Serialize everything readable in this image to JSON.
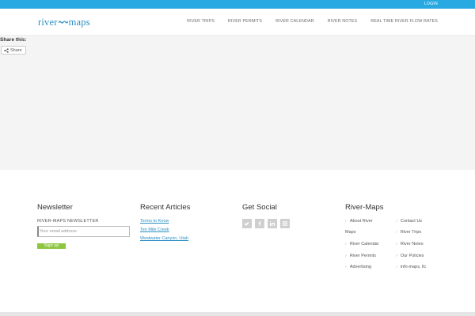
{
  "topbar": {
    "login": "LOGIN"
  },
  "logo": {
    "left": "river",
    "right": "maps"
  },
  "nav": [
    "RIVER TRIPS",
    "RIVER PERMITS",
    "RIVER CALENDAR",
    "RIVER NOTES",
    "REAL TIME RIVER FLOW RATES"
  ],
  "share": {
    "title": "Share this:",
    "button": "Share"
  },
  "footer": {
    "newsletter": {
      "heading": "Newsletter",
      "label": "RIVER-MAPS NEWSLETTER",
      "placeholder": "Your email address",
      "button": "Sign up"
    },
    "articles": {
      "heading": "Recent Articles",
      "items": [
        "Terms to Know",
        "Ten Mile Creek",
        "Westwater Canyon, Utah"
      ]
    },
    "social": {
      "heading": "Get Social",
      "icons": [
        "twitter-icon",
        "facebook-icon",
        "linkedin-icon",
        "instagram-icon"
      ]
    },
    "links": {
      "heading": "River-Maps",
      "items": [
        "About River",
        "Maps",
        "River Calendar",
        "River Permits",
        "Advertising",
        "Contact Us",
        "River Trips",
        "River Notes",
        "Our Policies",
        "info-maps, llc"
      ]
    }
  },
  "colors": {
    "accent": "#29a9e1",
    "link": "#2a8fc4",
    "signup": "#8dc63f"
  }
}
